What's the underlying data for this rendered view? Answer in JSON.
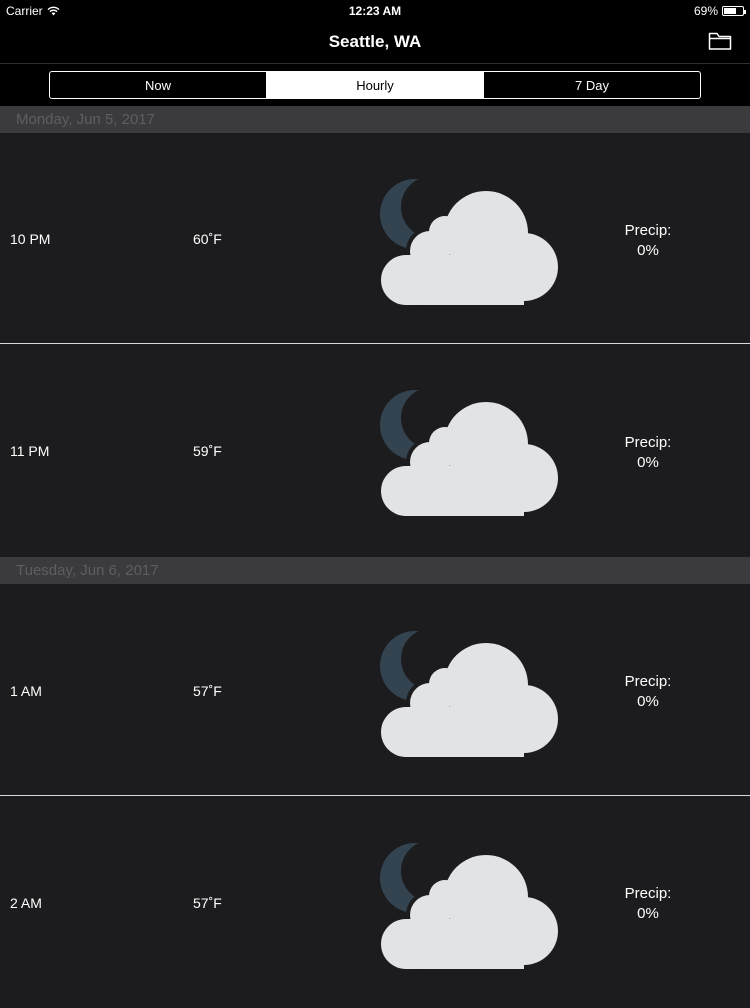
{
  "status": {
    "carrier": "Carrier",
    "time": "12:23 AM",
    "battery": "69%",
    "battery_level": 0.69
  },
  "nav": {
    "title": "Seattle, WA",
    "folder_icon": "folder-icon"
  },
  "segments": [
    {
      "label": "Now",
      "active": false
    },
    {
      "label": "Hourly",
      "active": true
    },
    {
      "label": "7 Day",
      "active": false
    }
  ],
  "sections": [
    {
      "header": "Monday, Jun 5, 2017",
      "rows": [
        {
          "time": "10 PM",
          "temp": "60˚F",
          "icon": "partly-cloudy-night-icon",
          "precip_label": "Precip:",
          "precip_value": "0%"
        },
        {
          "time": "11 PM",
          "temp": "59˚F",
          "icon": "partly-cloudy-night-icon",
          "precip_label": "Precip:",
          "precip_value": "0%"
        }
      ]
    },
    {
      "header": "Tuesday, Jun 6, 2017",
      "rows": [
        {
          "time": "1 AM",
          "temp": "57˚F",
          "icon": "partly-cloudy-night-icon",
          "precip_label": "Precip:",
          "precip_value": "0%"
        },
        {
          "time": "2 AM",
          "temp": "57˚F",
          "icon": "partly-cloudy-night-icon",
          "precip_label": "Precip:",
          "precip_value": "0%"
        }
      ]
    }
  ],
  "colors": {
    "moon": "#334450",
    "cloud": "#e2e3e5",
    "header_bg": "#3b3b3d",
    "header_text": "#5e5e62"
  }
}
